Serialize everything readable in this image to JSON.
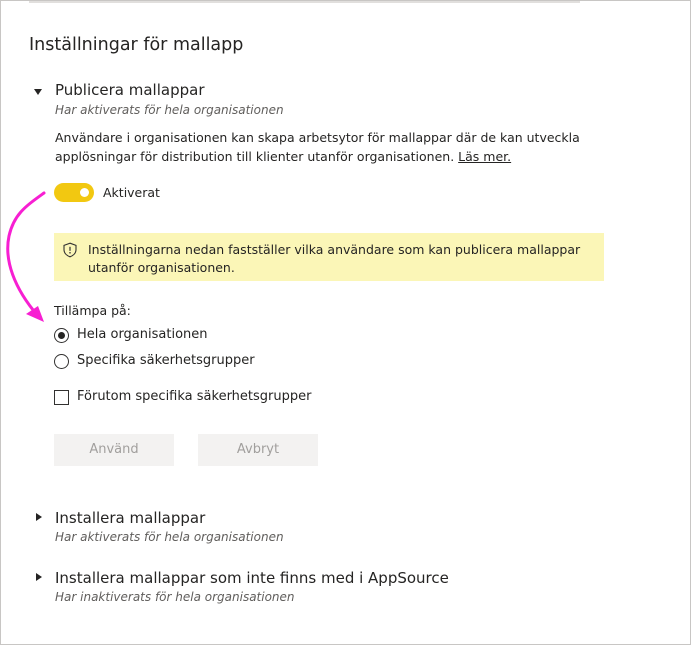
{
  "page": {
    "title": "Inställningar för mallapp"
  },
  "sections": [
    {
      "title": "Publicera mallappar",
      "status": "Har aktiverats för hela organisationen",
      "expanded": true,
      "description": "Användare i organisationen kan skapa arbetsytor för mallappar där de kan utveckla applösningar för distribution till klienter utanför organisationen.",
      "learn_more": "Läs mer.",
      "toggle": {
        "label": "Aktiverat",
        "on": true
      },
      "banner": {
        "icon": "shield-icon",
        "text": "Inställningarna nedan fastställer vilka användare som kan publicera mallappar utanför organisationen."
      },
      "apply_to": {
        "label": "Tillämpa på:",
        "options": [
          {
            "label": "Hela organisationen",
            "selected": true
          },
          {
            "label": "Specifika säkerhetsgrupper",
            "selected": false
          }
        ]
      },
      "except": {
        "label": "Förutom specifika säkerhetsgrupper",
        "checked": false
      },
      "buttons": {
        "apply": "Använd",
        "cancel": "Avbryt"
      }
    },
    {
      "title": "Installera mallappar",
      "status": "Har aktiverats för hela organisationen",
      "expanded": false
    },
    {
      "title": "Installera mallappar som inte finns med i AppSource",
      "status": "Har inaktiverats för hela organisationen",
      "expanded": false
    }
  ],
  "colors": {
    "toggle_on": "#f2c811",
    "banner_bg": "#fbf6b7",
    "annotation_arrow": "#f71fd2",
    "button_disabled_bg": "#f3f2f1",
    "button_disabled_text": "#a19f9d"
  }
}
